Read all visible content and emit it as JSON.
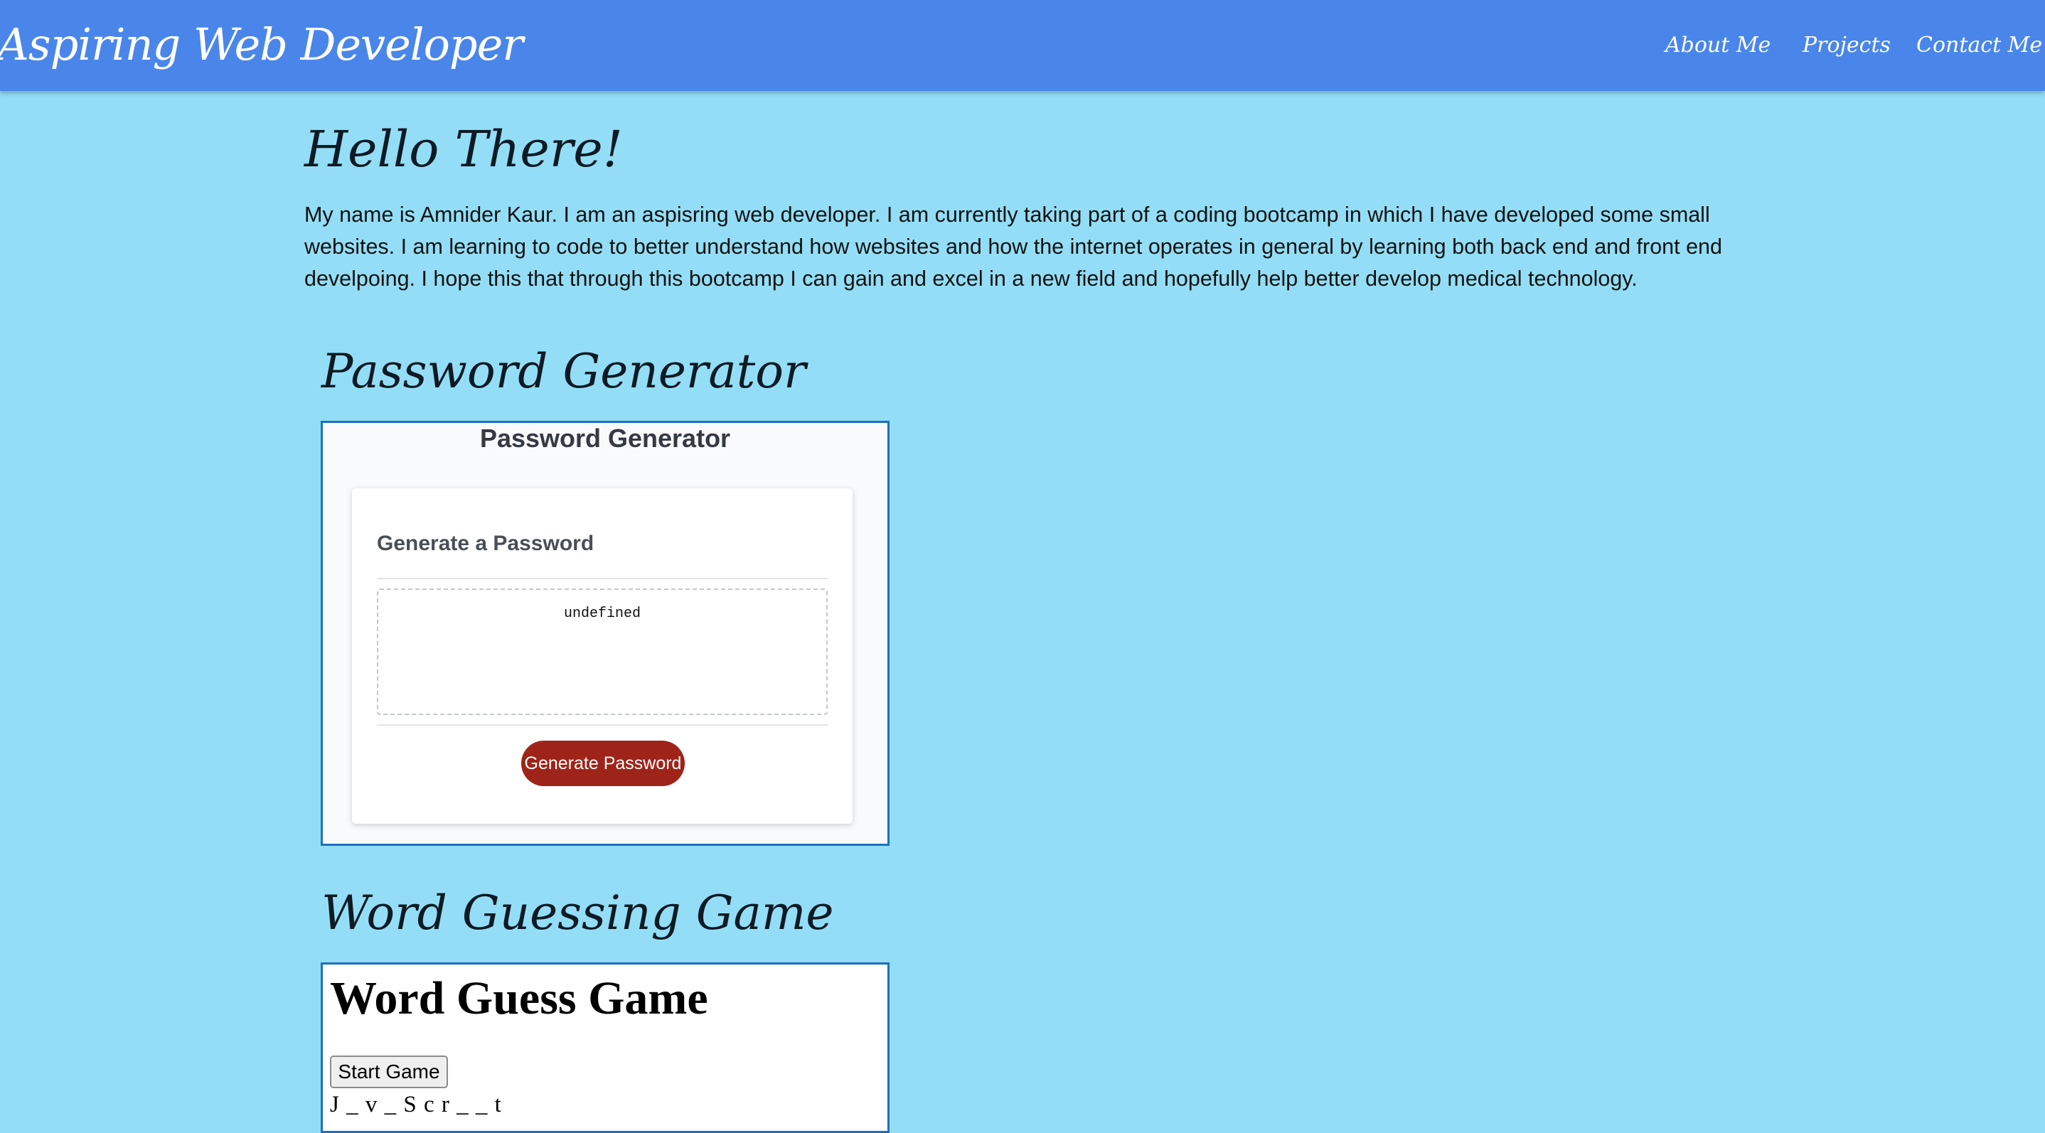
{
  "header": {
    "brand": "Aspiring Web Developer",
    "nav": [
      {
        "label": "About Me"
      },
      {
        "label": "Projects"
      },
      {
        "label": "Contact Me"
      }
    ]
  },
  "about": {
    "heading": "Hello There!",
    "text": "My name is Amnider Kaur. I am an aspisring web developer. I am currently taking part of a coding bootcamp in which I have developed some small websites. I am learning to code to better understand how websites and how the internet operates in general by learning both back end and front end develpoing. I hope this that through this bootcamp I can gain and excel in a new field and hopefully help better develop medical technology."
  },
  "projects": {
    "password_generator": {
      "section_title": "Password Generator",
      "page_heading": "Password Generator",
      "card_header": "Generate a Password",
      "output_value": "undefined",
      "button_label": "Generate Password"
    },
    "word_game": {
      "section_title": "Word Guessing Game",
      "page_heading": "Word Guess Game",
      "start_button_label": "Start Game",
      "word_display": "J _ v _ S c r _ _ t"
    }
  },
  "colors": {
    "page_background": "#93def6",
    "navbar_background": "#4a86ea",
    "generate_button": "#9e2419",
    "frame_border": "#1e6fc0"
  }
}
